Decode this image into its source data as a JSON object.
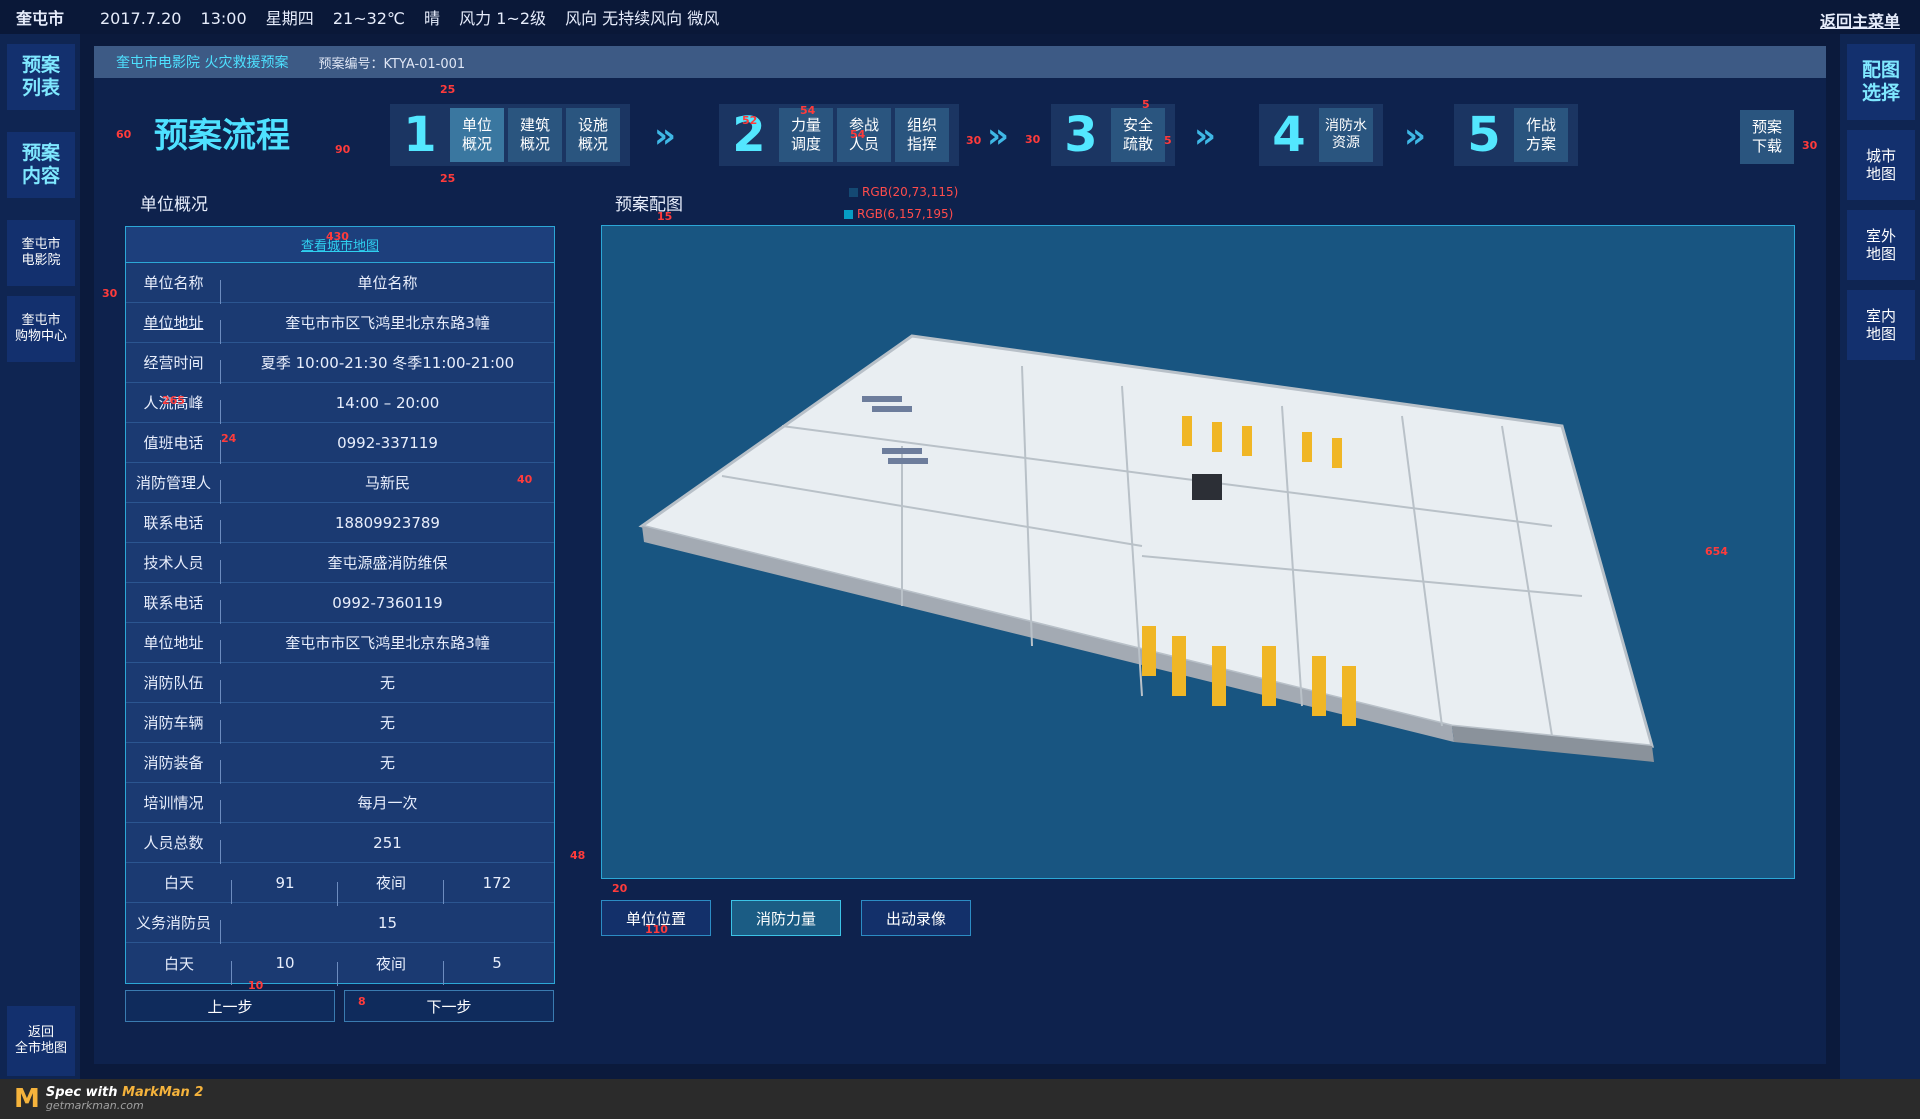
{
  "topbar": {
    "city": "奎屯市",
    "date": "2017.7.20",
    "time": "13:00",
    "weekday": "星期四",
    "temp": "21~32℃",
    "weather": "晴",
    "wind_force": "风力 1~2级",
    "wind_dir": "风向 无持续风向 微风",
    "back_label": "返回主菜单"
  },
  "left_sidebar": {
    "items": [
      {
        "label": "预案\n列表"
      },
      {
        "label": "预案\n内容"
      },
      {
        "label": "奎屯市\n电影院"
      },
      {
        "label": "奎屯市\n购物中心"
      }
    ],
    "bottom_label": "返回\n全市地图"
  },
  "right_sidebar": {
    "items": [
      {
        "label": "配图\n选择"
      },
      {
        "label": "城市\n地图"
      },
      {
        "label": "室外\n地图"
      },
      {
        "label": "室内\n地图"
      }
    ]
  },
  "crumb": {
    "title": "奎屯市电影院  火灾救援预案",
    "code": "预案编号：KTYA-01-001"
  },
  "flow": {
    "title": "预案流程",
    "steps": [
      {
        "num": "1",
        "subs": [
          "单位\n概况",
          "建筑\n概况",
          "设施\n概况"
        ]
      },
      {
        "num": "2",
        "subs": [
          "力量\n调度",
          "参战\n人员",
          "组织\n指挥"
        ]
      },
      {
        "num": "3",
        "subs": [
          "安全\n疏散"
        ]
      },
      {
        "num": "4",
        "subs": [
          "消防水\n资源"
        ]
      },
      {
        "num": "5",
        "subs": [
          "作战\n方案"
        ]
      }
    ],
    "download": "预案\n下载",
    "chevron": "»"
  },
  "unit": {
    "section_label": "单位概况",
    "map_link": "查看城市地图",
    "rows": [
      {
        "k": "单位名称",
        "v": "单位名称"
      },
      {
        "k": "单位地址",
        "v": "奎屯市市区飞鸿里北京东路3幢"
      },
      {
        "k": "经营时间",
        "v": "夏季 10:00-21:30  冬季11:00-21:00"
      },
      {
        "k": "人流高峰",
        "v": "14:00 – 20:00"
      },
      {
        "k": "值班电话",
        "v": "0992-337119"
      },
      {
        "k": "消防管理人",
        "v": "马新民"
      },
      {
        "k": "联系电话",
        "v": "18809923789"
      },
      {
        "k": "技术人员",
        "v": "奎屯源盛消防维保"
      },
      {
        "k": "联系电话",
        "v": "0992-7360119"
      },
      {
        "k": "单位地址",
        "v": "奎屯市市区飞鸿里北京东路3幢"
      },
      {
        "k": "消防队伍",
        "v": "无"
      },
      {
        "k": "消防车辆",
        "v": "无"
      },
      {
        "k": "消防装备",
        "v": "无"
      },
      {
        "k": "培训情况",
        "v": "每月一次"
      },
      {
        "k": "人员总数",
        "v": "251"
      }
    ],
    "split1": [
      "白天",
      "91",
      "夜间",
      "172"
    ],
    "volunteer": {
      "k": "义务消防员",
      "v": "15"
    },
    "split2": [
      "白天",
      "10",
      "夜间",
      "5"
    ],
    "prev": "上一步",
    "next": "下一步"
  },
  "map": {
    "section_label": "预案配图",
    "buttons": [
      "单位位置",
      "消防力量",
      "出动录像"
    ],
    "active_button": 1
  },
  "annotations": {
    "rgb1": "RGB(20,73,115)",
    "rgb1_color": "#144973",
    "rgb2": "RGB(6,157,195)",
    "rgb2_color": "#069dc3",
    "d25a": "25",
    "d25b": "25",
    "d60": "60",
    "d90": "90",
    "d52": "52",
    "d54a": "54",
    "d54b": "54",
    "d30a": "30",
    "d30b": "30",
    "d5a": "5",
    "d5b": "5",
    "d30c": "30",
    "d15": "15",
    "d430": "430",
    "d30d": "30",
    "d265": "265",
    "d24": "24",
    "d40": "40",
    "d654": "654",
    "d48": "48",
    "d20": "20",
    "d110": "110",
    "d10": "10",
    "d8": "8"
  },
  "footer": {
    "logo": "M",
    "line1a": "Spec with ",
    "line1b": "MarkMan 2",
    "line2": "getmarkman.com"
  }
}
